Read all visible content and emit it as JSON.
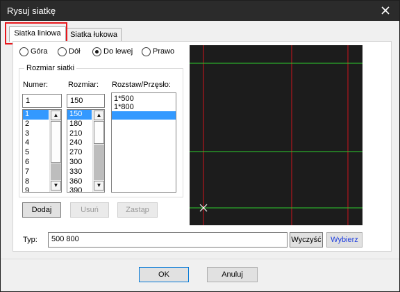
{
  "window": {
    "title": "Rysuj siatkę"
  },
  "tabs": [
    {
      "label": "Siatka liniowa",
      "active": true
    },
    {
      "label": "Siatka łukowa",
      "active": false
    }
  ],
  "direction": {
    "options": [
      "Góra",
      "Dół",
      "Do lewej",
      "Prawo"
    ],
    "selected": "Do lewej"
  },
  "group": {
    "title": "Rozmiar siatki",
    "numer_label": "Numer:",
    "numer_value": "1",
    "numer_items": [
      "1",
      "2",
      "3",
      "4",
      "5",
      "6",
      "7",
      "8",
      "9"
    ],
    "rozmiar_label": "Rozmiar:",
    "rozmiar_value": "150",
    "rozmiar_items": [
      "150",
      "180",
      "210",
      "240",
      "270",
      "300",
      "330",
      "360",
      "390"
    ],
    "rozstaw_label": "Rozstaw/Przęsło:",
    "rozstaw_items": [
      "1*500",
      "1*800",
      ""
    ]
  },
  "buttons": {
    "dodaj": "Dodaj",
    "usun": "Usuń",
    "zastap": "Zastąp",
    "wyczysc": "Wyczyść",
    "wybierz": "Wybierz",
    "ok": "OK",
    "anuluj": "Anuluj"
  },
  "typ": {
    "label": "Typ:",
    "value": "500 800"
  },
  "preview": {
    "background": "#1c1c1c",
    "vertical_line_color": "#d0141c",
    "horizontal_line_color": "#2ed12e",
    "origin_marker_color": "#ffffff"
  },
  "colors": {
    "highlight": "#e8171c",
    "selection": "#3399ff",
    "link_blue": "#1f3fdf"
  }
}
